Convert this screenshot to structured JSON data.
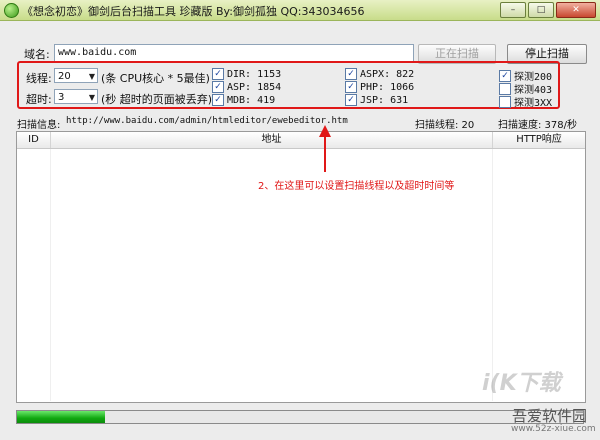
{
  "window": {
    "title": "《想念初恋》御剑后台扫描工具 珍藏版 By:御剑孤独 QQ:343034656",
    "minimize": "–",
    "maximize": "□",
    "close": "✕"
  },
  "domain": {
    "label": "域名:",
    "value": "www.baidu.com",
    "scanning_button": "正在扫描",
    "stop_button": "停止扫描"
  },
  "settings": {
    "threads_label": "线程:",
    "threads_value": "20",
    "threads_note": "(条 CPU核心 * 5最佳)",
    "timeout_label": "超时:",
    "timeout_value": "3",
    "timeout_note": "(秒 超时的页面被丢弃)",
    "dicts": [
      {
        "label": "DIR: 1153",
        "checked": true
      },
      {
        "label": "ASP: 1854",
        "checked": true
      },
      {
        "label": "MDB: 419",
        "checked": true
      },
      {
        "label": "ASPX: 822",
        "checked": true
      },
      {
        "label": "PHP: 1066",
        "checked": true
      },
      {
        "label": "JSP: 631",
        "checked": true
      }
    ],
    "probes": [
      {
        "label": "探测200",
        "checked": true
      },
      {
        "label": "探测403",
        "checked": false
      },
      {
        "label": "探测3XX",
        "checked": false
      }
    ]
  },
  "status": {
    "info_label": "扫描信息:",
    "info_url": "http://www.baidu.com/admin/htmleditor/ewebeditor.htm",
    "threads_text": "扫描线程: 20",
    "speed_text": "扫描速度: 378/秒"
  },
  "table": {
    "columns": [
      "ID",
      "地址",
      "HTTP响应"
    ]
  },
  "annotation": "2、在这里可以设置扫描线程以及超时时间等",
  "progress": {
    "fraction": 0.155
  },
  "watermark": {
    "logo": "i(K下载",
    "text": "吾爱软件园",
    "url": "www.52z-xiue.com"
  },
  "colors": {
    "annotation": "#e01818",
    "progress": "#10a810"
  }
}
